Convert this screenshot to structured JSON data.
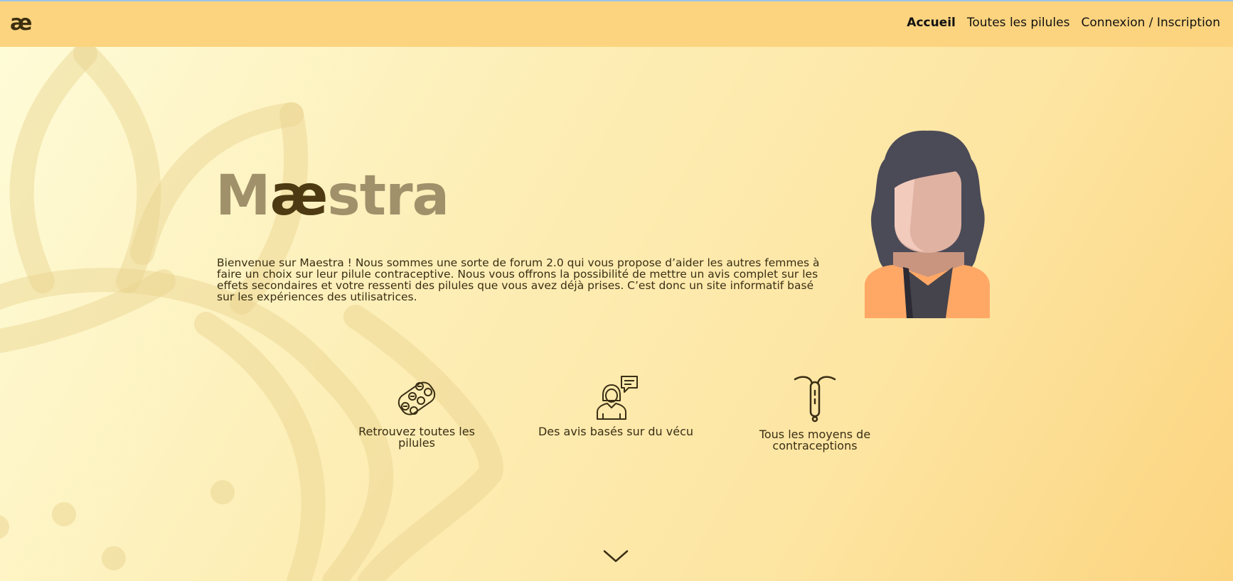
{
  "nav": {
    "logo": "æ",
    "links": [
      {
        "label": "Accueil",
        "active": true
      },
      {
        "label": "Toutes les pilules",
        "active": false
      },
      {
        "label": "Connexion / Inscription",
        "active": false
      }
    ]
  },
  "hero": {
    "title_prefix": "M",
    "title_highlight": "æ",
    "title_suffix": "stra",
    "intro": "Bienvenue sur Maestra ! Nous sommes une sorte de forum 2.0 qui vous propose d’aider les autres femmes à faire un choix sur leur pilule contraceptive. Nous vous offrons la possibilité de mettre un avis complet sur les effets secondaires et votre ressenti des pilules que vous avez déjà prises. C’est donc un site informatif basé sur les expériences des utilisatrices."
  },
  "features": [
    {
      "icon": "pill-blister-icon",
      "label": "Retrouvez toutes les pilules"
    },
    {
      "icon": "woman-speech-bubble-icon",
      "label": "Des avis basés sur du vécu"
    },
    {
      "icon": "iud-icon",
      "label": "Tous les moyens de contraceptions"
    }
  ],
  "icons": {
    "scroll": "chevron-down-icon",
    "avatar": "woman-avatar-illustration"
  },
  "colors": {
    "navbar": "#fcd47f",
    "background_start": "#fefcd9",
    "background_end": "#fcd47f",
    "title_light": "#a0916b",
    "title_dark": "#4d3a12",
    "text": "#3a2e14"
  }
}
